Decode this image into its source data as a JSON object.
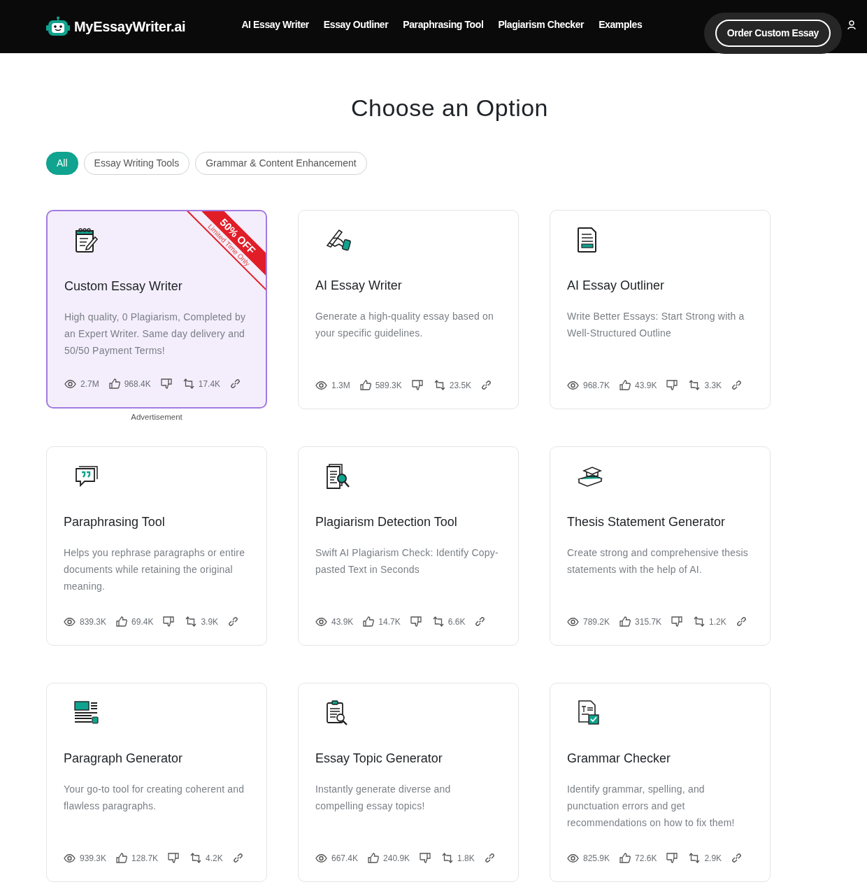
{
  "header": {
    "logo": "MyEssayWriter.ai",
    "nav": [
      "AI Essay Writer",
      "Essay Outliner",
      "Paraphrasing Tool",
      "Plagiarism Checker",
      "Examples"
    ],
    "cta": "Order Custom Essay"
  },
  "title": "Choose an Option",
  "filters": [
    {
      "label": "All",
      "selected": true
    },
    {
      "label": "Essay Writing Tools",
      "selected": false
    },
    {
      "label": "Grammar & Content Enhancement",
      "selected": false
    }
  ],
  "cards": [
    {
      "title": "Custom Essay Writer",
      "description": "High quality, 0 Plagiarism, Completed by an Expert Writer. Same day delivery and 50/50 Payment Terms!",
      "views": "2.7M",
      "likes": "968.4K",
      "shares": "17.4K",
      "featured": true,
      "ribbon": {
        "label": "50% OFF",
        "sublabel": "Limited Time Only"
      },
      "note": "Advertisement"
    },
    {
      "title": "AI Essay Writer",
      "description": "Generate a high-quality essay based on your specific guidelines.",
      "views": "1.3M",
      "likes": "589.3K",
      "shares": "23.5K",
      "featured": false
    },
    {
      "title": "AI Essay Outliner",
      "description": "Write Better Essays: Start Strong with a Well-Structured Outline",
      "views": "968.7K",
      "likes": "43.9K",
      "shares": "3.3K",
      "featured": false
    },
    {
      "title": "Paraphrasing Tool",
      "description": "Helps you rephrase paragraphs or entire documents while retaining the original meaning.",
      "views": "839.3K",
      "likes": "69.4K",
      "shares": "3.9K",
      "featured": false
    },
    {
      "title": "Plagiarism Detection Tool",
      "description": "Swift AI Plagiarism Check: Identify Copy-pasted Text in Seconds",
      "views": "43.9K",
      "likes": "14.7K",
      "shares": "6.6K",
      "featured": false
    },
    {
      "title": "Thesis Statement Generator",
      "description": "Create strong and comprehensive thesis statements with the help of AI.",
      "views": "789.2K",
      "likes": "315.7K",
      "shares": "1.2K",
      "featured": false
    },
    {
      "title": "Paragraph Generator",
      "description": "Your go-to tool for creating coherent and flawless paragraphs.",
      "views": "939.3K",
      "likes": "128.7K",
      "shares": "4.2K",
      "featured": false
    },
    {
      "title": "Essay Topic Generator",
      "description": "Instantly generate diverse and compelling essay topics!",
      "views": "667.4K",
      "likes": "240.9K",
      "shares": "1.8K",
      "featured": false
    },
    {
      "title": "Grammar Checker",
      "description": "Identify grammar, spelling, and punctuation errors and get recommendations on how to fix them!",
      "views": "825.9K",
      "likes": "72.6K",
      "shares": "2.9K",
      "featured": false
    }
  ]
}
